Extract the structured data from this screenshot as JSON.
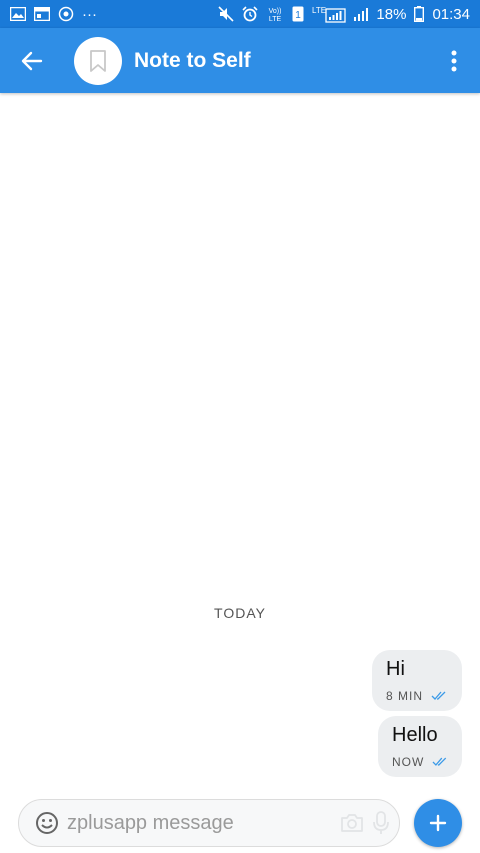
{
  "status_bar": {
    "battery_percent": "18%",
    "time": "01:34",
    "sim_slot": "1",
    "network": "LTE",
    "volte": "VoLTE",
    "more": "···",
    "icons": [
      "gallery-icon",
      "calendar-icon",
      "sync-icon",
      "more-dots-icon",
      "mute-icon",
      "alarm-icon",
      "volte-icon",
      "sim-icon",
      "lte-signal-icon",
      "signal-icon",
      "battery-icon"
    ]
  },
  "app_bar": {
    "title": "Note to Self",
    "back_icon": "arrow-back-icon",
    "avatar_icon": "bookmark-icon",
    "overflow_icon": "more-vertical-icon"
  },
  "conversation": {
    "date_divider": "TODAY",
    "messages": [
      {
        "text": "Hi",
        "time": "8 MIN",
        "status": "delivered"
      },
      {
        "text": "Hello",
        "time": "NOW",
        "status": "delivered"
      }
    ]
  },
  "composer": {
    "placeholder": "zplusapp message",
    "value": "",
    "emoji_icon": "emoji-icon",
    "camera_icon": "camera-icon",
    "mic_icon": "mic-icon",
    "send_icon": "plus-icon"
  },
  "colors": {
    "status_bar": "#1a7ad8",
    "app_bar": "#2f8ee6",
    "bubble": "#eceef0",
    "accent": "#2f8ee6",
    "tick": "#3b9ae8"
  }
}
